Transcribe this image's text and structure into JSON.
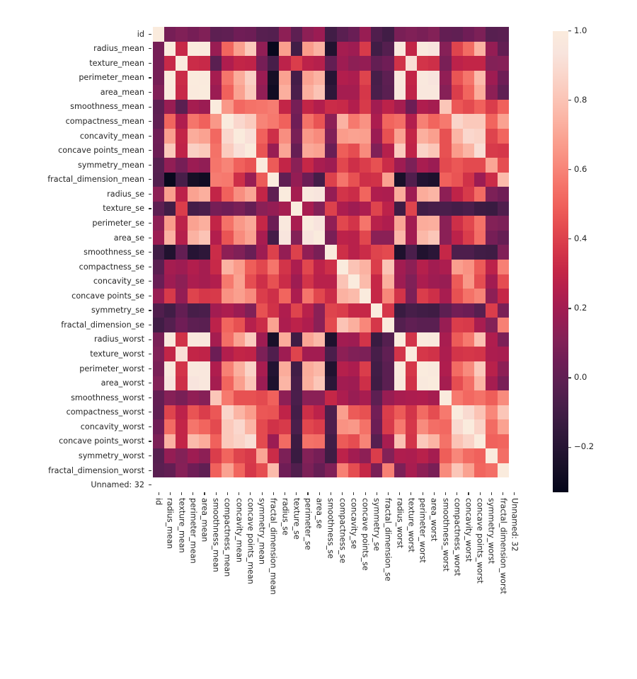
{
  "figure": {
    "type": "correlation-heatmap",
    "background": "#ffffff"
  },
  "chart_data": {
    "type": "heatmap",
    "title": "",
    "xlabel": "",
    "ylabel": "",
    "colormap": "rocket",
    "vmin": -0.33,
    "vmax": 1.0,
    "grid": false,
    "annotated": false,
    "colorbar": {
      "position": "right",
      "orientation": "vertical",
      "ticks": [
        1.0,
        0.8,
        0.6,
        0.4,
        0.2,
        0.0,
        -0.2
      ],
      "tick_labels": [
        "1.0",
        "0.8",
        "0.6",
        "0.4",
        "0.2",
        "0.0",
        "−0.2"
      ],
      "gradient_stops": [
        "#03051A",
        "#150E25",
        "#251433",
        "#361A3F",
        "#481E4A",
        "#5C1F52",
        "#6F1D56",
        "#842157",
        "#9A1C53",
        "#AF1D4E",
        "#C32547",
        "#D43649",
        "#E34A4F",
        "#EF5F5A",
        "#F5746A",
        "#F88B7D",
        "#FAA08F",
        "#FBB4A4",
        "#FBC6B8",
        "#FAD6CB",
        "#F8E4DD",
        "#FAEBDD"
      ]
    },
    "categories": [
      "id",
      "radius_mean",
      "texture_mean",
      "perimeter_mean",
      "area_mean",
      "smoothness_mean",
      "compactness_mean",
      "concavity_mean",
      "concave points_mean",
      "symmetry_mean",
      "fractal_dimension_mean",
      "radius_se",
      "texture_se",
      "perimeter_se",
      "area_se",
      "smoothness_se",
      "compactness_se",
      "concavity_se",
      "concave points_se",
      "symmetry_se",
      "fractal_dimension_se",
      "radius_worst",
      "texture_worst",
      "perimeter_worst",
      "area_worst",
      "smoothness_worst",
      "compactness_worst",
      "concavity_worst",
      "concave points_worst",
      "symmetry_worst",
      "fractal_dimension_worst",
      "Unnamed: 32"
    ],
    "xtick_labels": [
      "id",
      "radius_mean",
      "texture_mean",
      "perimeter_mean",
      "area_mean",
      "smoothness_mean",
      "compactness_mean",
      "concavity_mean",
      "concave points_mean",
      "symmetry_mean",
      "fractal_dimension_mean",
      "radius_se",
      "texture_se",
      "perimeter_se",
      "area_se",
      "smoothness_se",
      "compactness_se",
      "concavity_se",
      "concave points_se",
      "symmetry_se",
      "fractal_dimension_se",
      "radius_worst",
      "texture_worst",
      "perimeter_worst",
      "area_worst",
      "smoothness_worst",
      "compactness_worst",
      "concavity_worst",
      "concave points_worst",
      "symmetry_worst",
      "fractal_dimension_worst",
      "Unnamed: 32"
    ],
    "ytick_labels": [
      "id",
      "radius_mean",
      "texture_mean",
      "perimeter_mean",
      "area_mean",
      "smoothness_mean",
      "compactness_mean",
      "concavity_mean",
      "concave points_mean",
      "symmetry_mean",
      "fractal_dimension_mean",
      "radius_se",
      "texture_se",
      "perimeter_se",
      "area_se",
      "smoothness_se",
      "compactness_se",
      "concavity_se",
      "concave points_se",
      "symmetry_se",
      "fractal_dimension_se",
      "radius_worst",
      "texture_worst",
      "perimeter_worst",
      "area_worst",
      "smoothness_worst",
      "compactness_worst",
      "concavity_worst",
      "concave points_worst",
      "symmetry_worst",
      "fractal_dimension_worst",
      "Unnamed: 32"
    ],
    "nan_rows": [
      "Unnamed: 32"
    ],
    "nan_columns": [
      "Unnamed: 32"
    ],
    "nan_color": "#ffffff",
    "matrix": [
      [
        1.0,
        0.07,
        0.1,
        0.07,
        0.1,
        -0.01,
        0.0,
        0.05,
        0.04,
        -0.03,
        -0.04,
        0.14,
        -0.01,
        0.14,
        0.18,
        -0.1,
        -0.02,
        0.03,
        0.17,
        -0.05,
        -0.1,
        0.08,
        0.1,
        0.08,
        0.11,
        0.01,
        -0.0,
        0.05,
        0.09,
        -0.03,
        -0.02,
        null
      ],
      [
        0.07,
        1.0,
        0.32,
        1.0,
        0.99,
        0.17,
        0.51,
        0.68,
        0.82,
        0.15,
        -0.31,
        0.68,
        -0.1,
        0.67,
        0.74,
        -0.22,
        0.21,
        0.19,
        0.38,
        -0.1,
        -0.04,
        0.97,
        0.3,
        0.97,
        0.94,
        0.12,
        0.41,
        0.53,
        0.74,
        0.16,
        0.01,
        null
      ],
      [
        0.07,
        0.32,
        1.0,
        0.33,
        0.32,
        -0.02,
        0.24,
        0.3,
        0.29,
        0.07,
        -0.08,
        0.28,
        0.39,
        0.28,
        0.26,
        0.01,
        0.19,
        0.14,
        0.16,
        0.01,
        0.05,
        0.35,
        0.91,
        0.36,
        0.34,
        0.08,
        0.28,
        0.3,
        0.3,
        0.11,
        0.12,
        null
      ],
      [
        0.07,
        1.0,
        0.33,
        1.0,
        0.99,
        0.21,
        0.56,
        0.72,
        0.85,
        0.18,
        -0.26,
        0.69,
        -0.09,
        0.69,
        0.74,
        -0.2,
        0.25,
        0.23,
        0.41,
        -0.08,
        -0.01,
        0.97,
        0.3,
        0.97,
        0.94,
        0.15,
        0.46,
        0.56,
        0.77,
        0.19,
        0.05,
        null
      ],
      [
        0.1,
        0.99,
        0.32,
        0.99,
        1.0,
        0.18,
        0.5,
        0.69,
        0.82,
        0.15,
        -0.28,
        0.73,
        -0.07,
        0.73,
        0.8,
        -0.17,
        0.21,
        0.21,
        0.37,
        -0.07,
        -0.02,
        0.96,
        0.29,
        0.96,
        0.96,
        0.12,
        0.39,
        0.51,
        0.72,
        0.14,
        0.0,
        null
      ],
      [
        -0.01,
        0.17,
        -0.02,
        0.21,
        0.18,
        1.0,
        0.66,
        0.52,
        0.55,
        0.56,
        0.58,
        0.3,
        0.07,
        0.3,
        0.25,
        0.33,
        0.32,
        0.25,
        0.38,
        0.2,
        0.28,
        0.21,
        0.04,
        0.24,
        0.21,
        0.81,
        0.47,
        0.43,
        0.5,
        0.39,
        0.5,
        null
      ],
      [
        0.0,
        0.51,
        0.24,
        0.56,
        0.5,
        0.66,
        1.0,
        0.88,
        0.83,
        0.6,
        0.57,
        0.5,
        0.05,
        0.55,
        0.46,
        0.14,
        0.74,
        0.57,
        0.64,
        0.23,
        0.51,
        0.54,
        0.25,
        0.59,
        0.51,
        0.57,
        0.87,
        0.82,
        0.82,
        0.51,
        0.69,
        null
      ],
      [
        0.05,
        0.68,
        0.3,
        0.72,
        0.69,
        0.52,
        0.88,
        1.0,
        0.92,
        0.5,
        0.34,
        0.63,
        0.08,
        0.66,
        0.62,
        0.1,
        0.67,
        0.69,
        0.68,
        0.18,
        0.45,
        0.69,
        0.3,
        0.73,
        0.68,
        0.45,
        0.75,
        0.88,
        0.86,
        0.41,
        0.51,
        null
      ],
      [
        0.04,
        0.82,
        0.29,
        0.85,
        0.82,
        0.55,
        0.83,
        0.92,
        1.0,
        0.46,
        0.17,
        0.7,
        0.02,
        0.71,
        0.69,
        0.03,
        0.49,
        0.44,
        0.62,
        0.1,
        0.26,
        0.83,
        0.29,
        0.86,
        0.81,
        0.45,
        0.67,
        0.75,
        0.91,
        0.38,
        0.37,
        null
      ],
      [
        -0.03,
        0.15,
        0.07,
        0.18,
        0.15,
        0.56,
        0.6,
        0.5,
        0.46,
        1.0,
        0.48,
        0.3,
        0.13,
        0.31,
        0.22,
        0.19,
        0.42,
        0.34,
        0.39,
        0.45,
        0.33,
        0.19,
        0.09,
        0.22,
        0.18,
        0.43,
        0.47,
        0.43,
        0.43,
        0.7,
        0.44,
        null
      ],
      [
        -0.04,
        -0.31,
        -0.08,
        -0.26,
        -0.28,
        0.58,
        0.57,
        0.34,
        0.17,
        0.48,
        1.0,
        0.0,
        0.16,
        0.04,
        -0.09,
        0.4,
        0.56,
        0.45,
        0.34,
        0.35,
        0.69,
        -0.25,
        -0.05,
        -0.21,
        -0.23,
        0.5,
        0.46,
        0.35,
        0.18,
        0.33,
        0.77,
        null
      ],
      [
        0.14,
        0.68,
        0.28,
        0.69,
        0.73,
        0.3,
        0.5,
        0.63,
        0.7,
        0.3,
        0.0,
        1.0,
        0.21,
        0.97,
        0.95,
        0.16,
        0.36,
        0.33,
        0.51,
        0.24,
        0.23,
        0.72,
        0.19,
        0.72,
        0.75,
        0.14,
        0.29,
        0.38,
        0.53,
        0.09,
        0.05,
        null
      ],
      [
        -0.01,
        -0.1,
        0.39,
        -0.09,
        -0.07,
        0.07,
        0.05,
        0.08,
        0.02,
        0.13,
        0.16,
        0.21,
        1.0,
        0.22,
        0.11,
        0.4,
        0.23,
        0.19,
        0.23,
        0.41,
        0.28,
        -0.11,
        0.41,
        -0.1,
        -0.08,
        -0.07,
        -0.09,
        -0.07,
        -0.12,
        -0.13,
        -0.05,
        null
      ],
      [
        0.14,
        0.67,
        0.28,
        0.69,
        0.73,
        0.3,
        0.55,
        0.66,
        0.71,
        0.31,
        0.04,
        0.97,
        0.22,
        1.0,
        0.94,
        0.15,
        0.42,
        0.36,
        0.56,
        0.27,
        0.24,
        0.7,
        0.2,
        0.72,
        0.73,
        0.13,
        0.34,
        0.42,
        0.55,
        0.11,
        0.09,
        null
      ],
      [
        0.18,
        0.74,
        0.26,
        0.74,
        0.8,
        0.25,
        0.46,
        0.62,
        0.69,
        0.22,
        -0.09,
        0.95,
        0.11,
        0.94,
        1.0,
        0.08,
        0.28,
        0.27,
        0.42,
        0.13,
        0.13,
        0.76,
        0.2,
        0.76,
        0.81,
        0.13,
        0.28,
        0.39,
        0.54,
        0.07,
        0.02,
        null
      ],
      [
        -0.1,
        -0.22,
        0.01,
        -0.2,
        -0.17,
        0.33,
        0.14,
        0.1,
        0.03,
        0.19,
        0.4,
        0.16,
        0.4,
        0.15,
        0.08,
        1.0,
        0.34,
        0.27,
        0.33,
        0.41,
        0.43,
        -0.23,
        -0.07,
        -0.22,
        -0.18,
        0.31,
        -0.06,
        -0.06,
        -0.1,
        -0.11,
        0.1,
        null
      ],
      [
        -0.02,
        0.21,
        0.19,
        0.25,
        0.21,
        0.32,
        0.74,
        0.67,
        0.49,
        0.42,
        0.56,
        0.36,
        0.23,
        0.42,
        0.28,
        0.34,
        1.0,
        0.8,
        0.74,
        0.39,
        0.8,
        0.2,
        0.14,
        0.26,
        0.2,
        0.23,
        0.68,
        0.64,
        0.48,
        0.28,
        0.59,
        null
      ],
      [
        0.03,
        0.19,
        0.14,
        0.23,
        0.21,
        0.25,
        0.57,
        0.69,
        0.44,
        0.34,
        0.45,
        0.33,
        0.19,
        0.36,
        0.27,
        0.27,
        0.8,
        1.0,
        0.77,
        0.31,
        0.73,
        0.19,
        0.1,
        0.23,
        0.19,
        0.17,
        0.48,
        0.66,
        0.44,
        0.2,
        0.44,
        null
      ],
      [
        0.17,
        0.38,
        0.16,
        0.41,
        0.37,
        0.38,
        0.64,
        0.68,
        0.62,
        0.39,
        0.34,
        0.51,
        0.23,
        0.56,
        0.42,
        0.33,
        0.74,
        0.77,
        1.0,
        0.31,
        0.61,
        0.36,
        0.09,
        0.39,
        0.34,
        0.22,
        0.45,
        0.55,
        0.6,
        0.14,
        0.31,
        null
      ],
      [
        -0.05,
        -0.1,
        0.01,
        -0.08,
        -0.07,
        0.2,
        0.23,
        0.18,
        0.1,
        0.45,
        0.35,
        0.24,
        0.41,
        0.27,
        0.13,
        0.41,
        0.39,
        0.31,
        0.31,
        1.0,
        0.37,
        -0.13,
        -0.08,
        -0.1,
        -0.11,
        -0.01,
        0.06,
        0.04,
        -0.03,
        0.39,
        0.08,
        null
      ],
      [
        -0.1,
        -0.04,
        0.05,
        -0.01,
        -0.02,
        0.28,
        0.51,
        0.45,
        0.26,
        0.33,
        0.69,
        0.23,
        0.28,
        0.24,
        0.13,
        0.43,
        0.8,
        0.73,
        0.61,
        0.37,
        1.0,
        -0.04,
        -0.0,
        -0.02,
        -0.02,
        0.17,
        0.39,
        0.38,
        0.22,
        0.11,
        0.59,
        null
      ],
      [
        0.08,
        0.97,
        0.35,
        0.97,
        0.96,
        0.21,
        0.54,
        0.69,
        0.83,
        0.19,
        -0.25,
        0.72,
        -0.11,
        0.7,
        0.76,
        -0.23,
        0.2,
        0.19,
        0.36,
        -0.13,
        -0.04,
        1.0,
        0.36,
        0.99,
        0.98,
        0.22,
        0.48,
        0.57,
        0.79,
        0.24,
        0.09,
        null
      ],
      [
        0.1,
        0.3,
        0.91,
        0.3,
        0.29,
        0.04,
        0.25,
        0.3,
        0.29,
        0.09,
        -0.05,
        0.19,
        0.41,
        0.2,
        0.2,
        -0.07,
        0.14,
        0.1,
        0.09,
        -0.08,
        -0.0,
        0.36,
        1.0,
        0.37,
        0.35,
        0.23,
        0.36,
        0.37,
        0.36,
        0.23,
        0.22,
        null
      ],
      [
        0.08,
        0.97,
        0.36,
        0.97,
        0.96,
        0.24,
        0.59,
        0.73,
        0.86,
        0.22,
        -0.21,
        0.72,
        -0.1,
        0.72,
        0.76,
        -0.22,
        0.26,
        0.23,
        0.39,
        -0.1,
        -0.02,
        0.99,
        0.37,
        1.0,
        0.98,
        0.24,
        0.53,
        0.62,
        0.82,
        0.27,
        0.14,
        null
      ],
      [
        0.11,
        0.94,
        0.34,
        0.94,
        0.96,
        0.21,
        0.51,
        0.68,
        0.81,
        0.18,
        -0.23,
        0.75,
        -0.08,
        0.73,
        0.81,
        -0.18,
        0.2,
        0.19,
        0.34,
        -0.11,
        -0.02,
        0.98,
        0.35,
        0.98,
        1.0,
        0.21,
        0.44,
        0.54,
        0.75,
        0.21,
        0.08,
        null
      ],
      [
        0.01,
        0.12,
        0.08,
        0.15,
        0.12,
        0.81,
        0.57,
        0.45,
        0.45,
        0.43,
        0.5,
        0.14,
        -0.07,
        0.13,
        0.13,
        0.31,
        0.23,
        0.17,
        0.22,
        -0.01,
        0.17,
        0.22,
        0.23,
        0.24,
        0.21,
        1.0,
        0.57,
        0.52,
        0.55,
        0.49,
        0.62,
        null
      ],
      [
        -0.0,
        0.41,
        0.28,
        0.46,
        0.39,
        0.47,
        0.87,
        0.75,
        0.67,
        0.47,
        0.46,
        0.29,
        -0.09,
        0.34,
        0.28,
        -0.06,
        0.68,
        0.48,
        0.45,
        0.06,
        0.39,
        0.48,
        0.36,
        0.53,
        0.44,
        0.57,
        1.0,
        0.89,
        0.8,
        0.61,
        0.81,
        null
      ],
      [
        0.05,
        0.53,
        0.3,
        0.56,
        0.51,
        0.43,
        0.82,
        0.88,
        0.75,
        0.43,
        0.35,
        0.38,
        -0.07,
        0.42,
        0.39,
        -0.06,
        0.64,
        0.66,
        0.55,
        0.04,
        0.38,
        0.57,
        0.37,
        0.62,
        0.54,
        0.52,
        0.89,
        1.0,
        0.86,
        0.53,
        0.69,
        null
      ],
      [
        0.09,
        0.74,
        0.3,
        0.77,
        0.72,
        0.5,
        0.82,
        0.86,
        0.91,
        0.43,
        0.18,
        0.53,
        -0.12,
        0.55,
        0.54,
        -0.1,
        0.48,
        0.44,
        0.6,
        -0.03,
        0.22,
        0.79,
        0.36,
        0.82,
        0.75,
        0.55,
        0.8,
        0.86,
        1.0,
        0.5,
        0.51,
        null
      ],
      [
        -0.03,
        0.16,
        0.11,
        0.19,
        0.14,
        0.39,
        0.51,
        0.41,
        0.38,
        0.7,
        0.33,
        0.09,
        -0.13,
        0.11,
        0.07,
        -0.11,
        0.28,
        0.2,
        0.14,
        0.39,
        0.11,
        0.24,
        0.23,
        0.27,
        0.21,
        0.49,
        0.61,
        0.53,
        0.5,
        1.0,
        0.54,
        null
      ],
      [
        -0.02,
        0.01,
        0.12,
        0.05,
        0.0,
        0.5,
        0.69,
        0.51,
        0.37,
        0.44,
        0.77,
        0.05,
        -0.05,
        0.09,
        0.02,
        0.1,
        0.59,
        0.44,
        0.31,
        0.08,
        0.59,
        0.09,
        0.22,
        0.14,
        0.08,
        0.62,
        0.81,
        0.69,
        0.51,
        0.54,
        1.0,
        null
      ],
      [
        null,
        null,
        null,
        null,
        null,
        null,
        null,
        null,
        null,
        null,
        null,
        null,
        null,
        null,
        null,
        null,
        null,
        null,
        null,
        null,
        null,
        null,
        null,
        null,
        null,
        null,
        null,
        null,
        null,
        null,
        null,
        null
      ]
    ]
  }
}
